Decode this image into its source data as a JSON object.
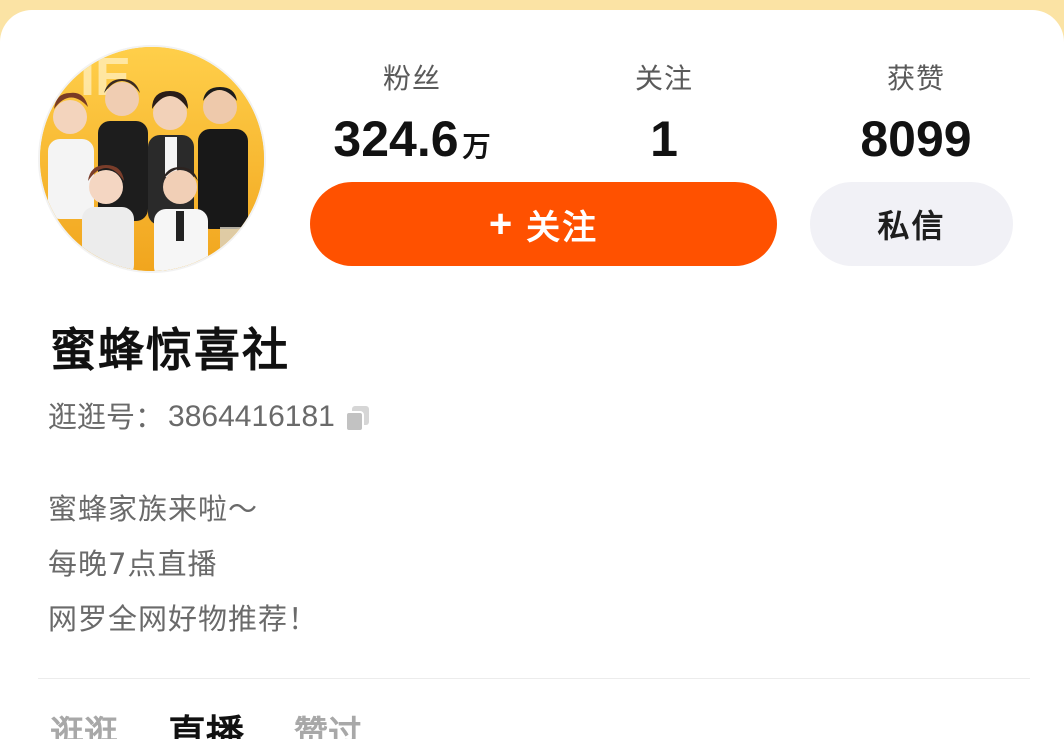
{
  "profile": {
    "avatar_icon": "group-photo-avatar",
    "name": "蜜蜂惊喜社",
    "id_label": "逛逛号：",
    "id_value": "3864416181",
    "bio": [
      "蜜蜂家族来啦～",
      "每晚7点直播",
      "网罗全网好物推荐！"
    ]
  },
  "stats": {
    "fans": {
      "label": "粉丝",
      "value": "324.6",
      "unit": "万"
    },
    "follow": {
      "label": "关注",
      "value": "1"
    },
    "likes": {
      "label": "获赞",
      "value": "8099"
    }
  },
  "actions": {
    "follow_plus": "+",
    "follow_label": "关注",
    "message_label": "私信",
    "follow_color": "#ff5100"
  },
  "tabs": [
    {
      "label": "逛逛"
    },
    {
      "label": "直播"
    },
    {
      "label": "赞过"
    }
  ]
}
